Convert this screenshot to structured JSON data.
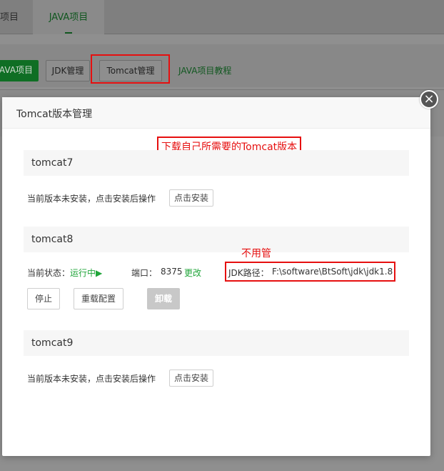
{
  "background": {
    "tabs": [
      {
        "label": "项目"
      },
      {
        "label": "JAVA项目"
      }
    ],
    "toolbar": {
      "java_btn": "JAVA项目",
      "jdk_btn": "JDK管理",
      "tomcat_btn": "Tomcat管理",
      "tutorial_link": "JAVA项目教程"
    }
  },
  "modal": {
    "title": "Tomcat版本管理",
    "close": "×",
    "annotation_main": "下载自己所需要的Tomcat版本",
    "annotation_jdk": "不用管",
    "versions": [
      {
        "name": "tomcat7",
        "status_text": "当前版本未安装，点击安装后操作",
        "install_label": "点击安装"
      },
      {
        "name": "tomcat8",
        "status_label": "当前状态：",
        "status_value": "运行中▶",
        "port_label": "端口：",
        "port_value": "8375",
        "change_label": "更改",
        "jdk_label": "JDK路径：",
        "jdk_value": "F:\\software\\BtSoft\\jdk\\jdk1.8",
        "stop_label": "停止",
        "reset_label": "重载配置",
        "uninstall_label": "卸载"
      },
      {
        "name": "tomcat9",
        "status_text": "当前版本未安装，点击安装后操作",
        "install_label": "点击安装"
      }
    ]
  },
  "colors": {
    "accent": "#20a53a",
    "annotation_red": "#e60f0f"
  }
}
